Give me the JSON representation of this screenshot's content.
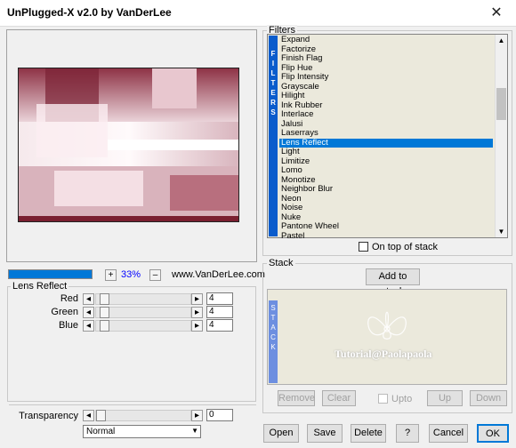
{
  "window": {
    "title": "UnPlugged-X v2.0 by VanDerLee",
    "close_icon": "close-icon"
  },
  "preview": {
    "zoom": "33%",
    "plus_label": "+",
    "minus_label": "–",
    "website": "www.VanDerLee.com"
  },
  "lens": {
    "group_label": "Lens Reflect",
    "params": [
      {
        "label": "Red",
        "value": "4"
      },
      {
        "label": "Green",
        "value": "4"
      },
      {
        "label": "Blue",
        "value": "4"
      }
    ]
  },
  "transparency": {
    "label": "Transparency",
    "value": "0",
    "blend_mode": "Normal"
  },
  "filters": {
    "group_label": "Filters",
    "strip_letters": [
      "F",
      "I",
      "L",
      "T",
      "E",
      "R",
      "S"
    ],
    "items": [
      "Expand",
      "Factorize",
      "Finish Flag",
      "Flip Hue",
      "Flip Intensity",
      "Grayscale",
      "Hilight",
      "Ink Rubber",
      "Interlace",
      "Jalusi",
      "Laserrays",
      "Lens Reflect",
      "Light",
      "Limitize",
      "Lomo",
      "Monotize",
      "Neighbor Blur",
      "Neon",
      "Noise",
      "Nuke",
      "Pantone Wheel",
      "Pastel"
    ],
    "selected": "Lens Reflect",
    "on_top_label": "On top of stack"
  },
  "stack": {
    "group_label": "Stack",
    "add_label": "Add to stack",
    "strip_letters": [
      "S",
      "T",
      "A",
      "C",
      "K"
    ],
    "watermark": "Tutorial@Paolapaola",
    "remove_label": "Remove",
    "clear_label": "Clear",
    "upto_label": "Upto",
    "up_label": "Up",
    "down_label": "Down"
  },
  "buttons": {
    "open": "Open",
    "save": "Save",
    "delete": "Delete",
    "help": "?",
    "cancel": "Cancel",
    "ok": "OK"
  },
  "colors": {
    "accent": "#0078d7",
    "preview_dark": "#7a1f30",
    "list_bg": "#ebe9dc"
  }
}
